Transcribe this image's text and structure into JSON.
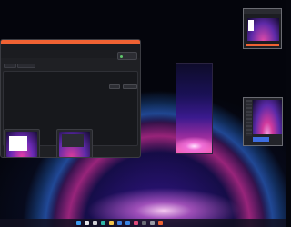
{
  "window": {
    "title_prefix": "",
    "title_link": "",
    "status": ""
  },
  "tabs": [
    "",
    ""
  ],
  "content": {
    "section_heading": "",
    "refresh_label": "",
    "create_label": "",
    "footer_note": "",
    "connection_note": ""
  },
  "screens": [
    {
      "label": "",
      "sub": "",
      "button": ""
    },
    {
      "label": "",
      "sub": "",
      "button": ""
    }
  ],
  "preview_right": {
    "tag": ""
  },
  "taskbar": {
    "time": "",
    "icons": [
      "windows-icon",
      "search-icon",
      "taskview-icon",
      "edge-icon",
      "explorer-icon",
      "store-icon",
      "mail-icon",
      "photos-icon",
      "terminal-icon",
      "settings-icon",
      "app-icon"
    ],
    "icon_colors": [
      "#3a9bf2",
      "#e6e6ea",
      "#d0d0d6",
      "#2fb6a8",
      "#f2c44b",
      "#3f7fe0",
      "#3a86e6",
      "#e04a7a",
      "#6b6d76",
      "#9a9ca6",
      "#ef6233"
    ]
  },
  "colors": {
    "accent": "#ef6233",
    "window_bg": "#1f2024",
    "status_online": "#5fc66b"
  }
}
